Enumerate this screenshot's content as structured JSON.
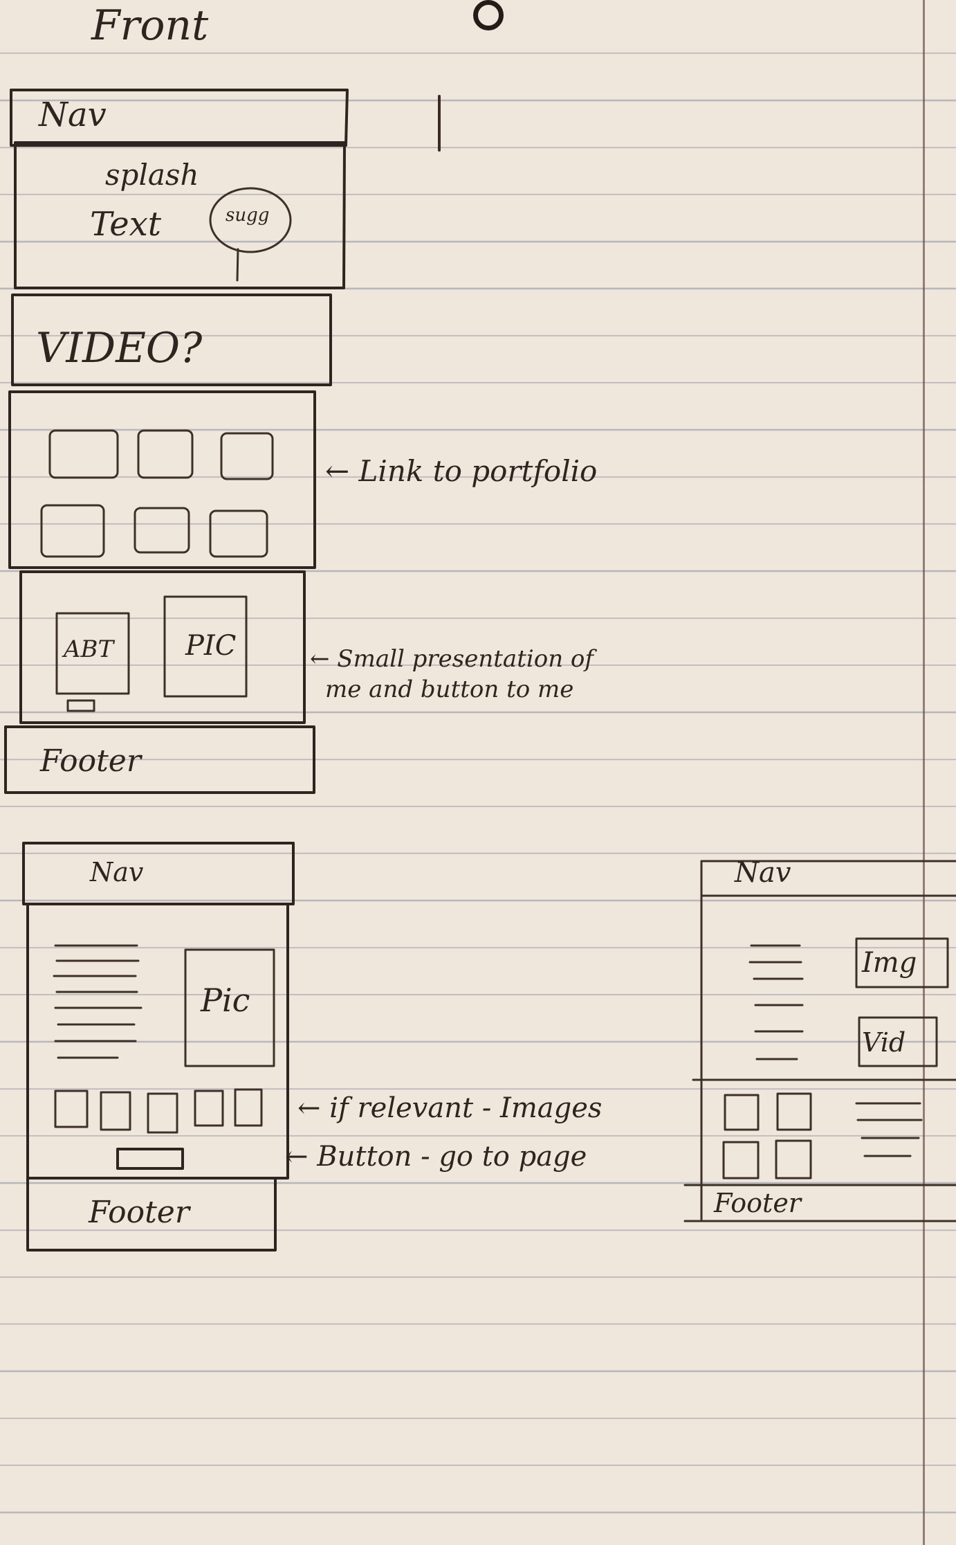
{
  "title": "Front",
  "top_wireframe": {
    "nav": "Nav",
    "splash_line1": "splash",
    "splash_line2": "Text",
    "splash_badge": "sugg",
    "video": "VIDEO?",
    "about": "ABT",
    "about_pic": "PIC",
    "footer": "Footer"
  },
  "annotations": {
    "portfolio": "← Link to portfolio",
    "presentation_line1": "← Small presentation of",
    "presentation_line2": "me and button to me",
    "images": "← if relevant - Images",
    "button": "← Button - go to page"
  },
  "middle_wireframe": {
    "nav": "Nav",
    "pic": "Pic",
    "footer": "Footer"
  },
  "right_wireframe": {
    "nav": "Nav",
    "img": "Img",
    "vid": "Vid",
    "footer": "Footer"
  }
}
